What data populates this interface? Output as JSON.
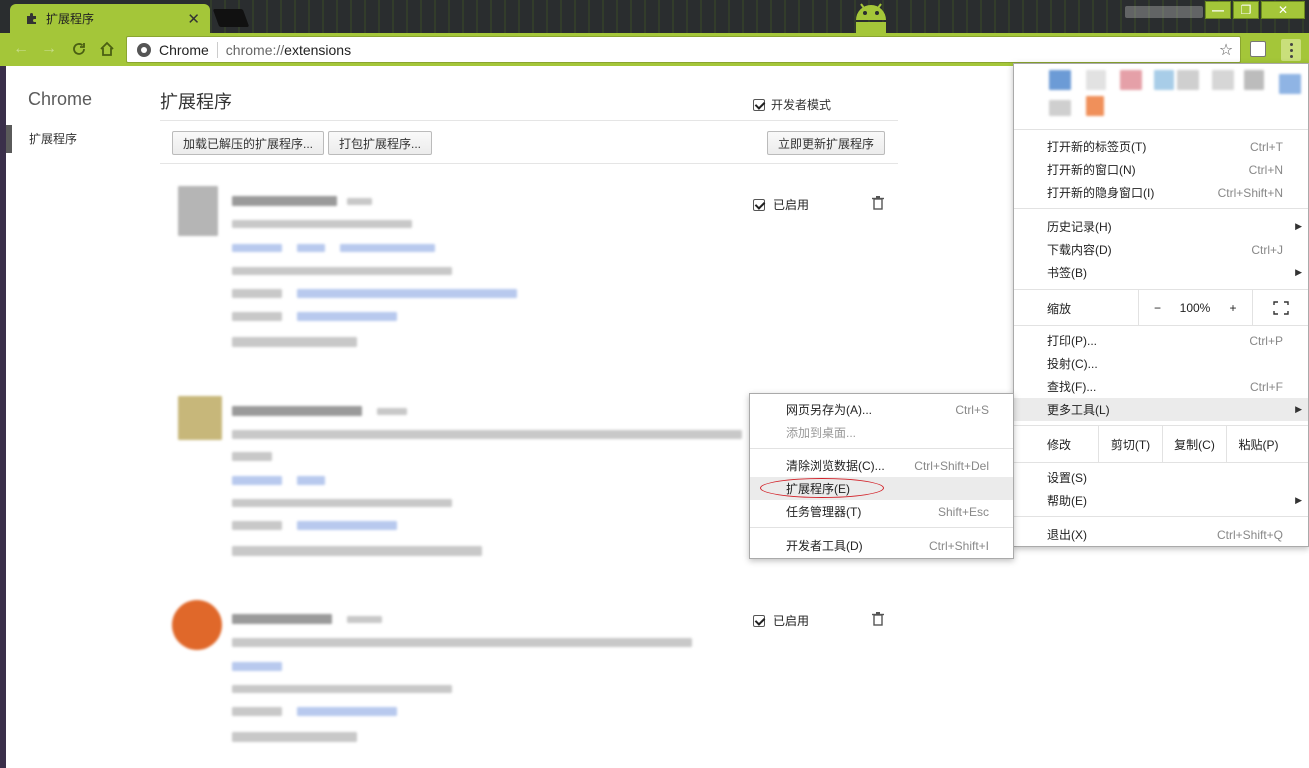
{
  "tab": {
    "title": "扩展程序",
    "close": "✕"
  },
  "toolbar": {
    "site": "Chrome",
    "url_scheme": "chrome://",
    "url_host": "extensions"
  },
  "window_controls": {
    "minimize": "—",
    "maximize": "❐",
    "close": "✕"
  },
  "sidebar": {
    "title": "Chrome",
    "items": [
      {
        "label": "扩展程序"
      }
    ]
  },
  "main": {
    "title": "扩展程序",
    "dev_mode_label": "开发者模式",
    "buttons": {
      "load_unpacked": "加载已解压的扩展程序...",
      "pack": "打包扩展程序...",
      "update": "立即更新扩展程序"
    },
    "enabled_label": "已启用"
  },
  "chrome_menu": {
    "items": [
      {
        "label": "打开新的标签页(T)",
        "shortcut": "Ctrl+T"
      },
      {
        "label": "打开新的窗口(N)",
        "shortcut": "Ctrl+N"
      },
      {
        "label": "打开新的隐身窗口(I)",
        "shortcut": "Ctrl+Shift+N"
      },
      {
        "label": "历史记录(H)",
        "shortcut": ""
      },
      {
        "label": "下载内容(D)",
        "shortcut": "Ctrl+J"
      },
      {
        "label": "书签(B)",
        "shortcut": ""
      },
      {
        "label": "打印(P)...",
        "shortcut": "Ctrl+P"
      },
      {
        "label": "投射(C)...",
        "shortcut": ""
      },
      {
        "label": "查找(F)...",
        "shortcut": "Ctrl+F"
      },
      {
        "label": "更多工具(L)",
        "shortcut": ""
      },
      {
        "label": "设置(S)",
        "shortcut": ""
      },
      {
        "label": "帮助(E)",
        "shortcut": ""
      },
      {
        "label": "退出(X)",
        "shortcut": "Ctrl+Shift+Q"
      }
    ],
    "zoom": {
      "label": "缩放",
      "minus": "−",
      "value": "100%",
      "plus": "+"
    },
    "edit": {
      "label": "修改",
      "cut": "剪切(T)",
      "copy": "复制(C)",
      "paste": "粘贴(P)"
    }
  },
  "more_tools_menu": {
    "items": [
      {
        "label": "网页另存为(A)...",
        "shortcut": "Ctrl+S"
      },
      {
        "label": "添加到桌面...",
        "shortcut": ""
      },
      {
        "label": "清除浏览数据(C)...",
        "shortcut": "Ctrl+Shift+Del"
      },
      {
        "label": "扩展程序(E)",
        "shortcut": ""
      },
      {
        "label": "任务管理器(T)",
        "shortcut": "Shift+Esc"
      },
      {
        "label": "开发者工具(D)",
        "shortcut": "Ctrl+Shift+I"
      }
    ]
  },
  "colors": {
    "theme": "#a4c639",
    "annotation": "#d3232a"
  }
}
